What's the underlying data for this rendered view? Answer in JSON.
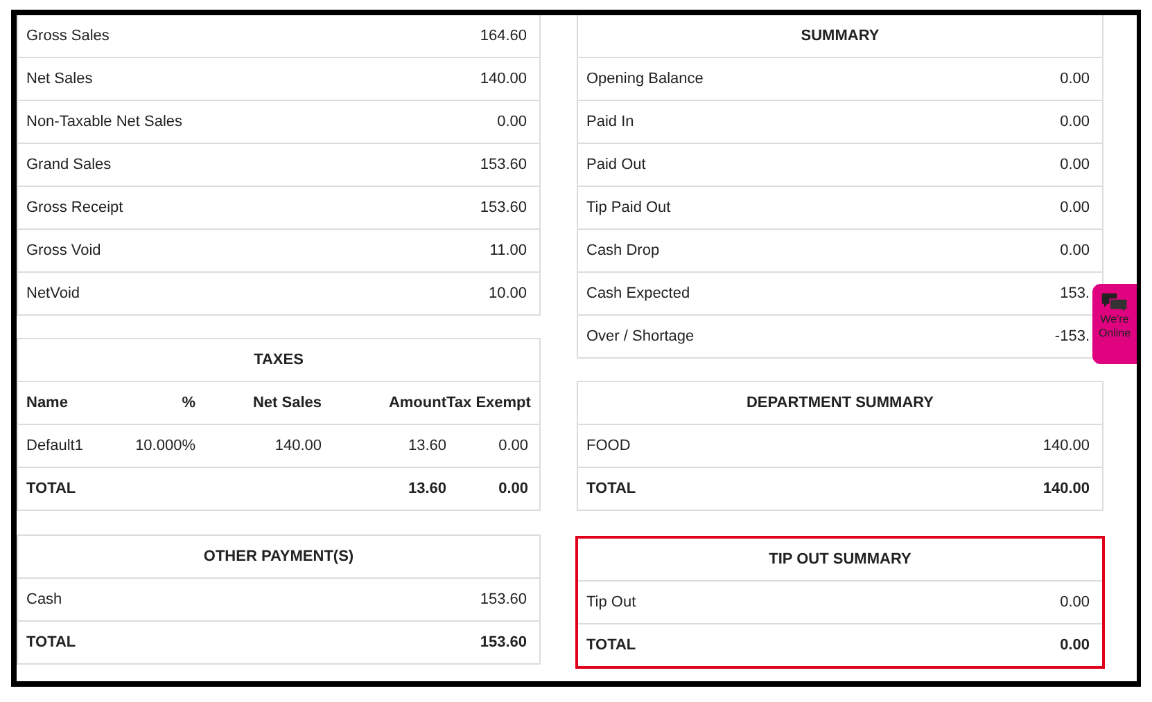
{
  "sales": [
    {
      "label": "Gross Sales",
      "value": "164.60"
    },
    {
      "label": "Net Sales",
      "value": "140.00"
    },
    {
      "label": "Non-Taxable Net Sales",
      "value": "0.00"
    },
    {
      "label": "Grand Sales",
      "value": "153.60"
    },
    {
      "label": "Gross Receipt",
      "value": "153.60"
    },
    {
      "label": "Gross Void",
      "value": "11.00"
    },
    {
      "label": "NetVoid",
      "value": "10.00"
    }
  ],
  "taxes": {
    "title": "TAXES",
    "columns": [
      "Name",
      "%",
      "Net Sales",
      "Amount",
      "Tax Exempt"
    ],
    "rows": [
      [
        "Default1",
        "10.000%",
        "140.00",
        "13.60",
        "0.00"
      ]
    ],
    "total": {
      "label": "TOTAL",
      "amount": "13.60",
      "tax_exempt": "0.00"
    }
  },
  "other_payments": {
    "title": "OTHER PAYMENT(S)",
    "rows": [
      {
        "label": "Cash",
        "value": "153.60"
      }
    ],
    "total": {
      "label": "TOTAL",
      "value": "153.60"
    },
    "highlighted": false
  },
  "summary": {
    "title": "SUMMARY",
    "rows": [
      {
        "label": "Opening Balance",
        "value": "0.00"
      },
      {
        "label": "Paid In",
        "value": "0.00"
      },
      {
        "label": "Paid Out",
        "value": "0.00"
      },
      {
        "label": "Tip Paid Out",
        "value": "0.00"
      },
      {
        "label": "Cash Drop",
        "value": "0.00"
      },
      {
        "label": "Cash Expected",
        "value": "153."
      },
      {
        "label": "Over / Shortage",
        "value": "-153."
      }
    ]
  },
  "department_summary": {
    "title": "DEPARTMENT SUMMARY",
    "rows": [
      {
        "label": "FOOD",
        "value": "140.00"
      }
    ],
    "total": {
      "label": "TOTAL",
      "value": "140.00"
    },
    "highlighted": false
  },
  "tip_out_summary": {
    "title": "TIP OUT SUMMARY",
    "rows": [
      {
        "label": "Tip Out",
        "value": "0.00"
      }
    ],
    "total": {
      "label": "TOTAL",
      "value": "0.00"
    },
    "highlighted": true
  },
  "chat_widget": {
    "lines": [
      "We're",
      "Online"
    ]
  }
}
